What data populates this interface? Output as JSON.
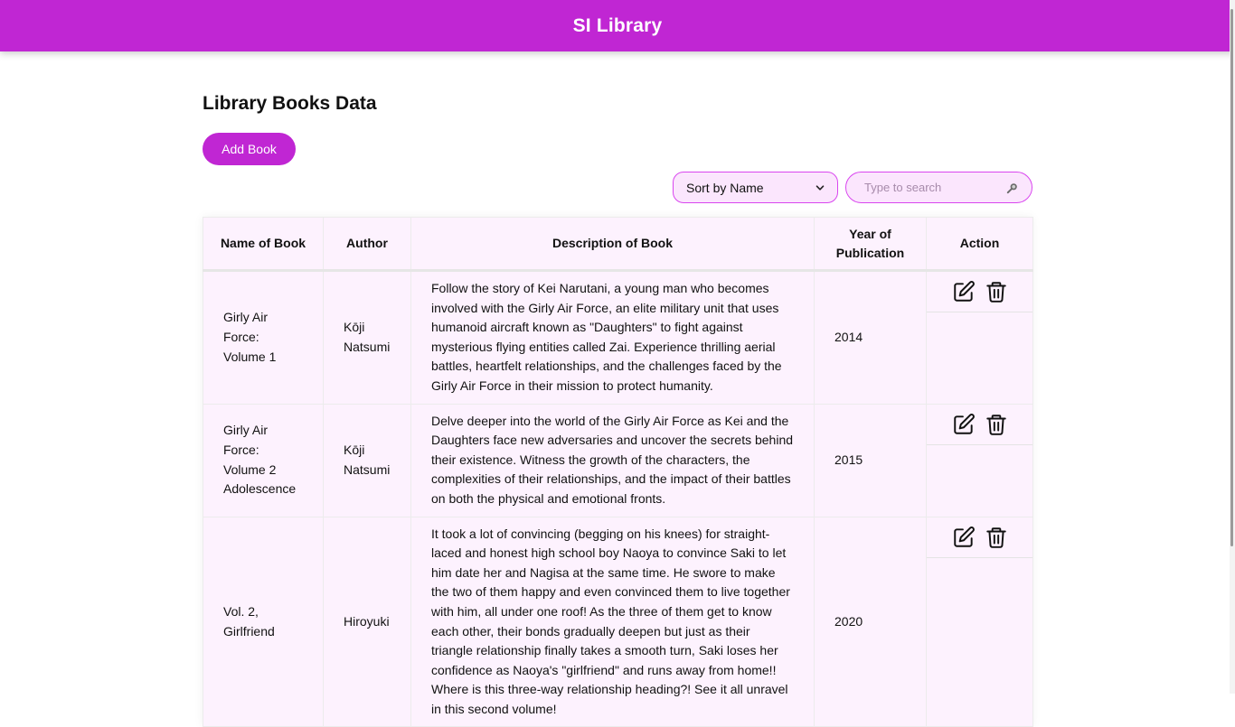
{
  "app": {
    "title": "SI Library"
  },
  "page": {
    "heading": "Library Books Data",
    "add_button": "Add Book"
  },
  "controls": {
    "sort": {
      "selected": "Sort by Name",
      "icon": "chevron-down-icon"
    },
    "search": {
      "placeholder": "Type to search",
      "value": "",
      "icon": "search-icon"
    }
  },
  "table": {
    "headers": [
      "Name of Book",
      "Author",
      "Description of Book",
      "Year of Publication",
      "Action"
    ],
    "rows": [
      {
        "name": "Girly Air Force: Volume 1",
        "author": "Kōji Natsumi",
        "description": "Follow the story of Kei Narutani, a young man who becomes involved with the Girly Air Force, an elite military unit that uses humanoid aircraft known as \"Daughters\" to fight against mysterious flying entities called Zai. Experience thrilling aerial battles, heartfelt relationships, and the challenges faced by the Girly Air Force in their mission to protect humanity.",
        "year": "2014"
      },
      {
        "name": "Girly Air Force: Volume 2 Adolescence",
        "author": "Kōji Natsumi",
        "description": "Delve deeper into the world of the Girly Air Force as Kei and the Daughters face new adversaries and uncover the secrets behind their existence. Witness the growth of the characters, the complexities of their relationships, and the impact of their battles on both the physical and emotional fronts.",
        "year": "2015"
      },
      {
        "name": "Vol. 2, Girlfriend",
        "author": "Hiroyuki",
        "description": "It took a lot of convincing (begging on his knees) for straight-laced and honest high school boy Naoya to convince Saki to let him date her and Nagisa at the same time. He swore to make the two of them happy and even convinced them to live together with him, all under one roof! As the three of them get to know each other, their bonds gradually deepen but just as their triangle relationship finally takes a smooth turn, Saki loses her confidence as Naoya's \"girlfriend\" and runs away from home!! Where is this three-way relationship heading?! See it all unravel in this second volume!",
        "year": "2020"
      }
    ],
    "row_actions": {
      "edit_icon": "edit-icon",
      "delete_icon": "trash-icon"
    }
  },
  "colors": {
    "brand": "#c026d3",
    "table_bg": "#fdf2fe",
    "input_border": "#d946ef"
  }
}
